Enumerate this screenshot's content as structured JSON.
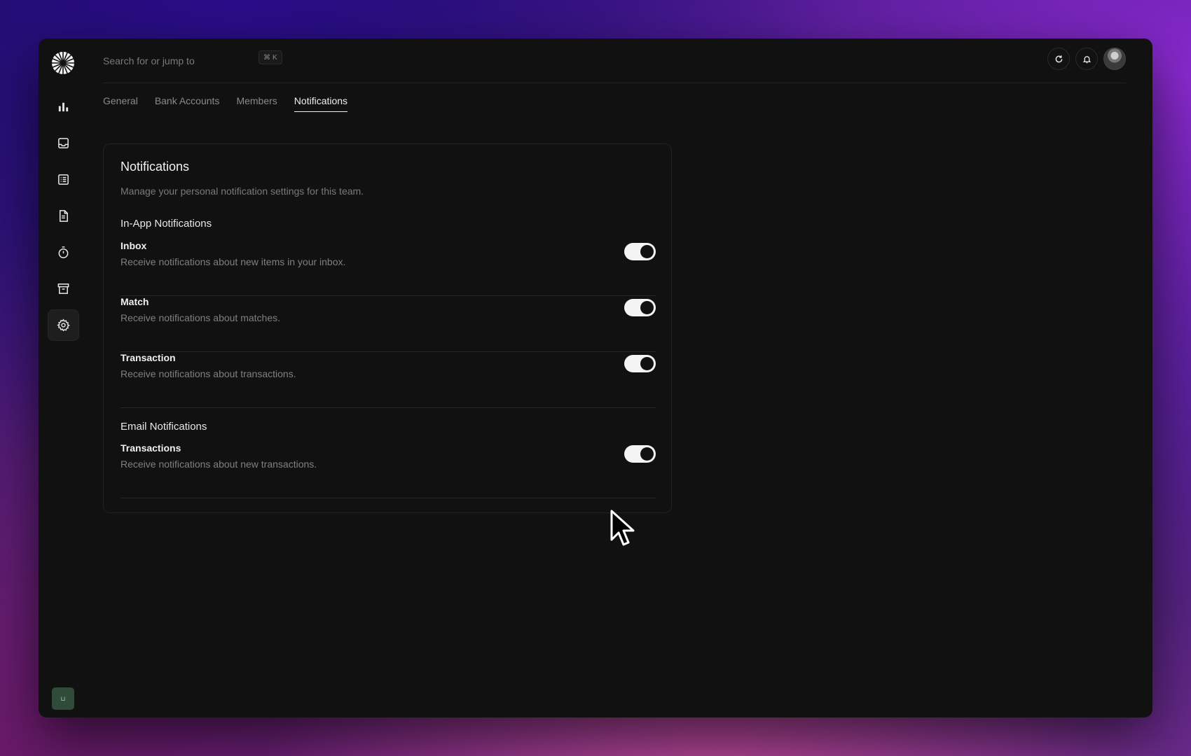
{
  "search": {
    "placeholder": "Search for or jump to",
    "shortcut_symbol": "⌘",
    "shortcut_key": "K"
  },
  "sidebar": {
    "items": [
      {
        "name": "overview",
        "icon": "bar-chart-icon"
      },
      {
        "name": "inbox",
        "icon": "inbox-tray-icon"
      },
      {
        "name": "transactions",
        "icon": "list-icon"
      },
      {
        "name": "invoices",
        "icon": "document-icon"
      },
      {
        "name": "tracker",
        "icon": "stopwatch-icon"
      },
      {
        "name": "vault",
        "icon": "archive-icon"
      },
      {
        "name": "settings",
        "icon": "gear-icon",
        "active": true
      }
    ],
    "team_badge": "⊔"
  },
  "tabs": [
    {
      "label": "General"
    },
    {
      "label": "Bank Accounts"
    },
    {
      "label": "Members"
    },
    {
      "label": "Notifications",
      "active": true
    }
  ],
  "card": {
    "title": "Notifications",
    "description": "Manage your personal notification settings for this team.",
    "in_app": {
      "title": "In-App Notifications",
      "rows": [
        {
          "title": "Inbox",
          "desc": "Receive notifications about new items in your inbox.",
          "enabled": true
        },
        {
          "title": "Match",
          "desc": "Receive notifications about matches.",
          "enabled": true
        },
        {
          "title": "Transaction",
          "desc": "Receive notifications about transactions.",
          "enabled": true
        }
      ]
    },
    "email": {
      "title": "Email Notifications",
      "rows": [
        {
          "title": "Transactions",
          "desc": "Receive notifications about new transactions.",
          "enabled": true
        }
      ]
    }
  },
  "colors": {
    "window_bg": "#111111",
    "toggle_on": "#f4f4f4",
    "accent_text": "#f0f0f0",
    "muted_text": "#808080"
  }
}
